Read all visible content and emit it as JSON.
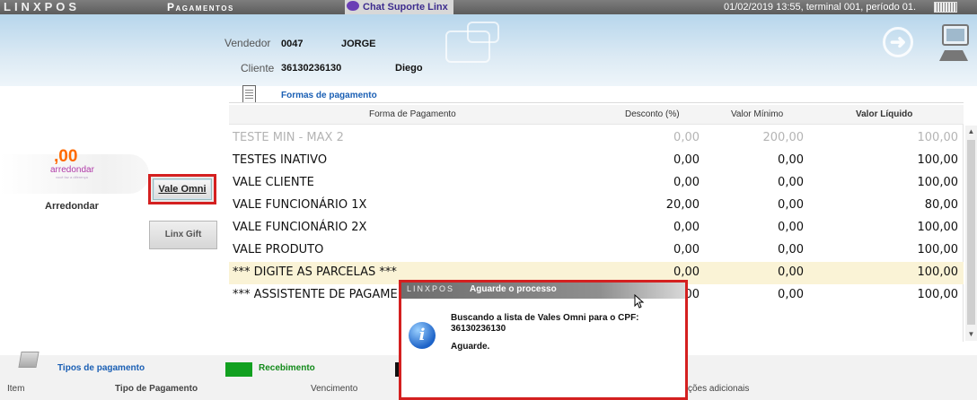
{
  "topbar": {
    "logo": "LINXPOS",
    "title": "Pagamentos",
    "chat_label": "Chat Suporte Linx",
    "info": "01/02/2019 13:55, terminal 001, período 01."
  },
  "header": {
    "vendedor_label": "Vendedor",
    "vendedor_code": "0047",
    "vendedor_name": "JORGE",
    "cliente_label": "Cliente",
    "cliente_code": "36130236130",
    "cliente_name": "Diego"
  },
  "left": {
    "round_logo_big": ",00",
    "round_logo_word": "arredondar",
    "round_logo_small": "você faz a diferença",
    "arredondar_label": "Arredondar",
    "vale_omni_button": "Vale Omni",
    "linx_gift_button": "Linx Gift"
  },
  "formas": {
    "section_label": "Formas de pagamento",
    "columns": [
      "Forma de Pagamento",
      "Desconto (%)",
      "Valor Mínimo",
      "Valor Líquido"
    ],
    "rows": [
      {
        "name": "TESTE MIN - MAX 2",
        "desconto": "0,00",
        "minimo": "200,00",
        "liquido": "100,00"
      },
      {
        "name": "TESTES INATIVO",
        "desconto": "0,00",
        "minimo": "0,00",
        "liquido": "100,00"
      },
      {
        "name": "VALE CLIENTE",
        "desconto": "0,00",
        "minimo": "0,00",
        "liquido": "100,00"
      },
      {
        "name": "VALE FUNCIONÁRIO 1X",
        "desconto": "20,00",
        "minimo": "0,00",
        "liquido": "80,00"
      },
      {
        "name": "VALE FUNCIONÁRIO 2X",
        "desconto": "0,00",
        "minimo": "0,00",
        "liquido": "100,00"
      },
      {
        "name": "VALE PRODUTO",
        "desconto": "0,00",
        "minimo": "0,00",
        "liquido": "100,00"
      },
      {
        "name": "*** DIGITE AS PARCELAS ***",
        "desconto": "0,00",
        "minimo": "0,00",
        "liquido": "100,00"
      },
      {
        "name": "*** ASSISTENTE DE PAGAME",
        "desconto": "00",
        "minimo": "0,00",
        "liquido": "100,00"
      }
    ]
  },
  "bottom": {
    "tipos_label": "Tipos de pagamento",
    "recebimento_label": "Recebimento",
    "columns": [
      "Item",
      "Tipo de Pagamento",
      "Vencimento",
      "ções adicionais"
    ]
  },
  "modal": {
    "logo": "LINXPOS",
    "title": "Aguarde o processo",
    "message_line1": "Buscando a lista de Vales Omni para o CPF:",
    "message_line2": "36130236130",
    "wait": "Aguarde."
  },
  "colors": {
    "highlight_red": "#d42020",
    "link_blue": "#1a5fb4",
    "receb_green": "#12a020",
    "selected_row": "#faf3d6"
  }
}
